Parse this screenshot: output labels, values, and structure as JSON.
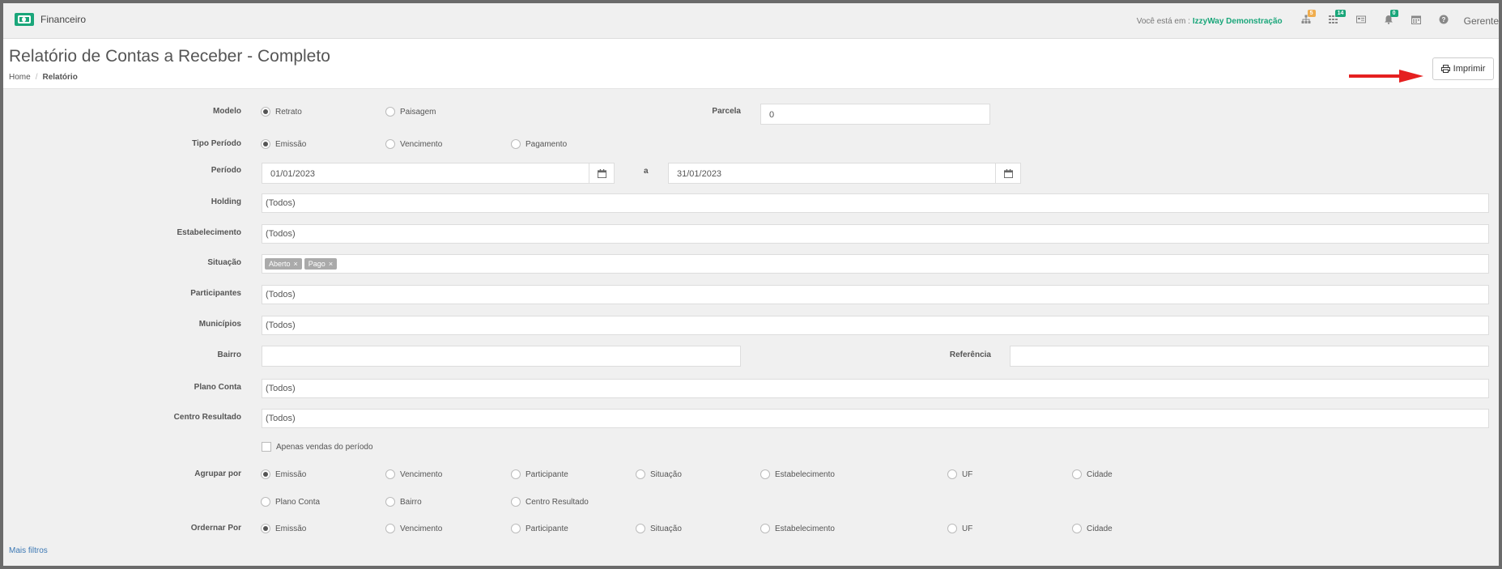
{
  "topbar": {
    "module": "Financeiro",
    "location_prefix": "Você está em :",
    "company": "IzzyWay Demonstração",
    "user": "Gerente",
    "icons": [
      {
        "name": "sitemap-icon",
        "badge": "5",
        "badge_color": "#f0ad4e"
      },
      {
        "name": "grid-icon",
        "badge": "14",
        "badge_color": "#1aa67a"
      },
      {
        "name": "card-icon",
        "badge": ""
      },
      {
        "name": "bell-icon",
        "badge": "0",
        "badge_color": "#1aa67a"
      },
      {
        "name": "calendar-icon",
        "badge": ""
      },
      {
        "name": "help-icon",
        "badge": ""
      }
    ]
  },
  "header": {
    "title": "Relatório de Contas a Receber - Completo",
    "breadcrumb": [
      "Home",
      "Relatório"
    ],
    "print_label": "Imprimir"
  },
  "form": {
    "modelo": {
      "label": "Modelo",
      "options": [
        "Retrato",
        "Paisagem"
      ],
      "selected": "Retrato"
    },
    "parcela": {
      "label": "Parcela",
      "value": "0"
    },
    "tipo_periodo": {
      "label": "Tipo Período",
      "options": [
        "Emissão",
        "Vencimento",
        "Pagamento"
      ],
      "selected": "Emissão"
    },
    "periodo": {
      "label": "Período",
      "start": "01/01/2023",
      "separator": "a",
      "end": "31/01/2023"
    },
    "holding": {
      "label": "Holding",
      "value": "(Todos)"
    },
    "estabelecimento": {
      "label": "Estabelecimento",
      "value": "(Todos)"
    },
    "situacao": {
      "label": "Situação",
      "tags": [
        "Aberto",
        "Pago"
      ]
    },
    "participantes": {
      "label": "Participantes",
      "value": "(Todos)"
    },
    "municipios": {
      "label": "Municípios",
      "value": "(Todos)"
    },
    "bairro": {
      "label": "Bairro",
      "value": ""
    },
    "referencia": {
      "label": "Referência",
      "value": ""
    },
    "plano_conta": {
      "label": "Plano Conta",
      "value": "(Todos)"
    },
    "centro_resultado": {
      "label": "Centro Resultado",
      "value": "(Todos)"
    },
    "apenas_vendas": {
      "label": "Apenas vendas do período",
      "checked": false
    },
    "agrupar_por": {
      "label": "Agrupar por",
      "options": [
        "Emissão",
        "Vencimento",
        "Participante",
        "Situação",
        "Estabelecimento",
        "UF",
        "Cidade",
        "Plano Conta",
        "Bairro",
        "Centro Resultado"
      ],
      "selected": "Emissão"
    },
    "ordenar_por": {
      "label": "Ordernar Por",
      "options": [
        "Emissão",
        "Vencimento",
        "Participante",
        "Situação",
        "Estabelecimento",
        "UF",
        "Cidade"
      ],
      "selected": "Emissão"
    },
    "mais_filtros": "Mais filtros"
  },
  "colors": {
    "accent": "#1aa67a",
    "link": "#3c78b4",
    "arrow": "#e52020"
  }
}
